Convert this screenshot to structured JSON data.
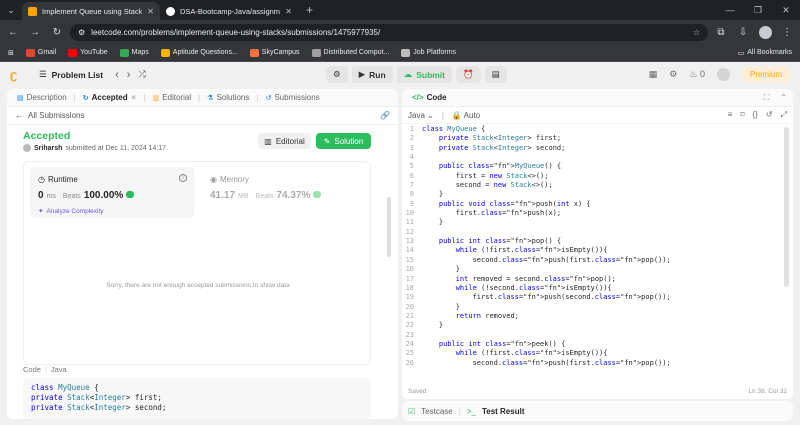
{
  "browser": {
    "tabs": [
      {
        "title": "Implement Queue using Stack",
        "active": true,
        "favicon_color": "#ffa116"
      },
      {
        "title": "DSA-Bootcamp-Java/assignme",
        "active": false,
        "favicon_color": "#ffffff"
      }
    ],
    "url": "leetcode.com/problems/implement-queue-using-stacks/submissions/1475977935/",
    "bookmarks": [
      {
        "label": "Gmail",
        "color": "#ea4335"
      },
      {
        "label": "YouTube",
        "color": "#ff0000"
      },
      {
        "label": "Maps",
        "color": "#34a853"
      },
      {
        "label": "Aptitude Questions...",
        "color": "#f4b400"
      },
      {
        "label": "SkyCampus",
        "color": "#ff7043"
      },
      {
        "label": "Distributed Comput...",
        "color": "#9e9e9e"
      },
      {
        "label": "Job Platforms",
        "color": "#bdbdbd"
      }
    ],
    "all_bookmarks": "All Bookmarks"
  },
  "header": {
    "problem_list": "Problem List",
    "run": "Run",
    "submit": "Submit",
    "streak": "0",
    "premium": "Premium"
  },
  "left": {
    "tabs": {
      "description": "Description",
      "accepted": "Accepted",
      "editorial": "Editorial",
      "solutions": "Solutions",
      "submissions": "Submissions"
    },
    "all_submissions": "All Submissions",
    "status": "Accepted",
    "user": "Sriharsh",
    "submitted_at": "submitted at Dec 11, 2024 14:17",
    "editorial_btn": "Editorial",
    "solution_btn": "Solution",
    "runtime": {
      "label": "Runtime",
      "value": "0",
      "unit": "ms",
      "beats_label": "Beats",
      "beats": "100.00%",
      "analyze": "Analyze Complexity"
    },
    "memory": {
      "label": "Memory",
      "value": "41.17",
      "unit": "MB",
      "beats_label": "Beats",
      "beats": "74.37%"
    },
    "sorry": "Sorry, there are not enough accepted submissions to show data",
    "code_label": "Code",
    "code_lang": "Java",
    "snippet": [
      "class MyQueue {",
      "    private Stack<Integer> first;",
      "    private Stack<Integer> second;"
    ]
  },
  "right": {
    "title": "Code",
    "lang": "Java",
    "auto": "Auto",
    "lines": [
      "class MyQueue {",
      "    private Stack<Integer> first;",
      "    private Stack<Integer> second;",
      "",
      "    public MyQueue() {",
      "        first = new Stack<>();",
      "        second = new Stack<>();",
      "    }",
      "    public void push(int x) {",
      "        first.push(x);",
      "    }",
      "",
      "    public int pop() {",
      "        while (!first.isEmpty()){",
      "            second.push(first.pop());",
      "        }",
      "        int removed = second.pop();",
      "        while (!second.isEmpty()){",
      "            first.push(second.pop());",
      "        }",
      "        return removed;",
      "    }",
      "",
      "    public int peek() {",
      "        while (!first.isEmpty()){",
      "            second.push(first.pop());"
    ],
    "saved": "Saved",
    "cursor": "Ln 38, Col 32"
  },
  "bottom": {
    "testcase": "Testcase",
    "test_result": "Test Result"
  }
}
